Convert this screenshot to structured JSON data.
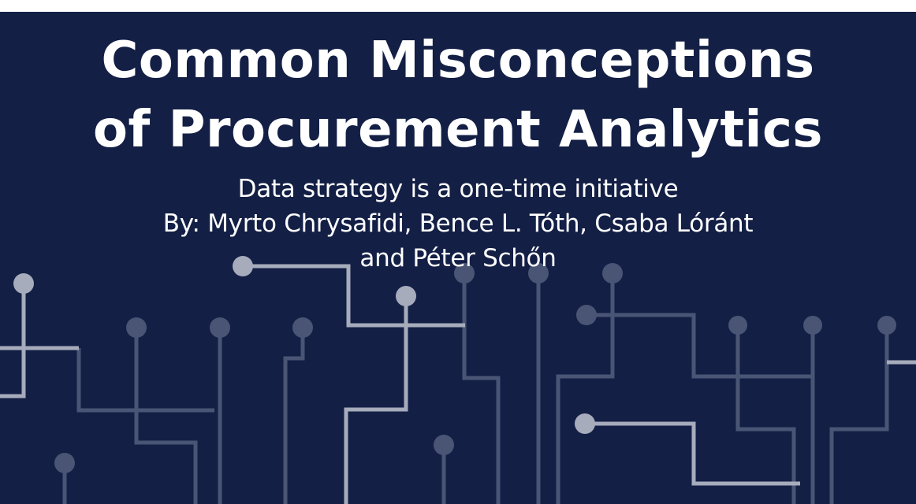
{
  "banner": {
    "title_line_1": "Common Misconceptions",
    "title_line_2": "of Procurement Analytics",
    "subtitle": "Data strategy is a one-time initiative",
    "authors_line_1": "By: Myrto Chrysafidi, Bence L. Tóth, Csaba Lóránt",
    "authors_line_2": "and Péter Schőn"
  },
  "colors": {
    "background": "#131f45",
    "text": "#ffffff",
    "circuit_dim": "#4a5575",
    "circuit_bright": "#a7acbc"
  }
}
